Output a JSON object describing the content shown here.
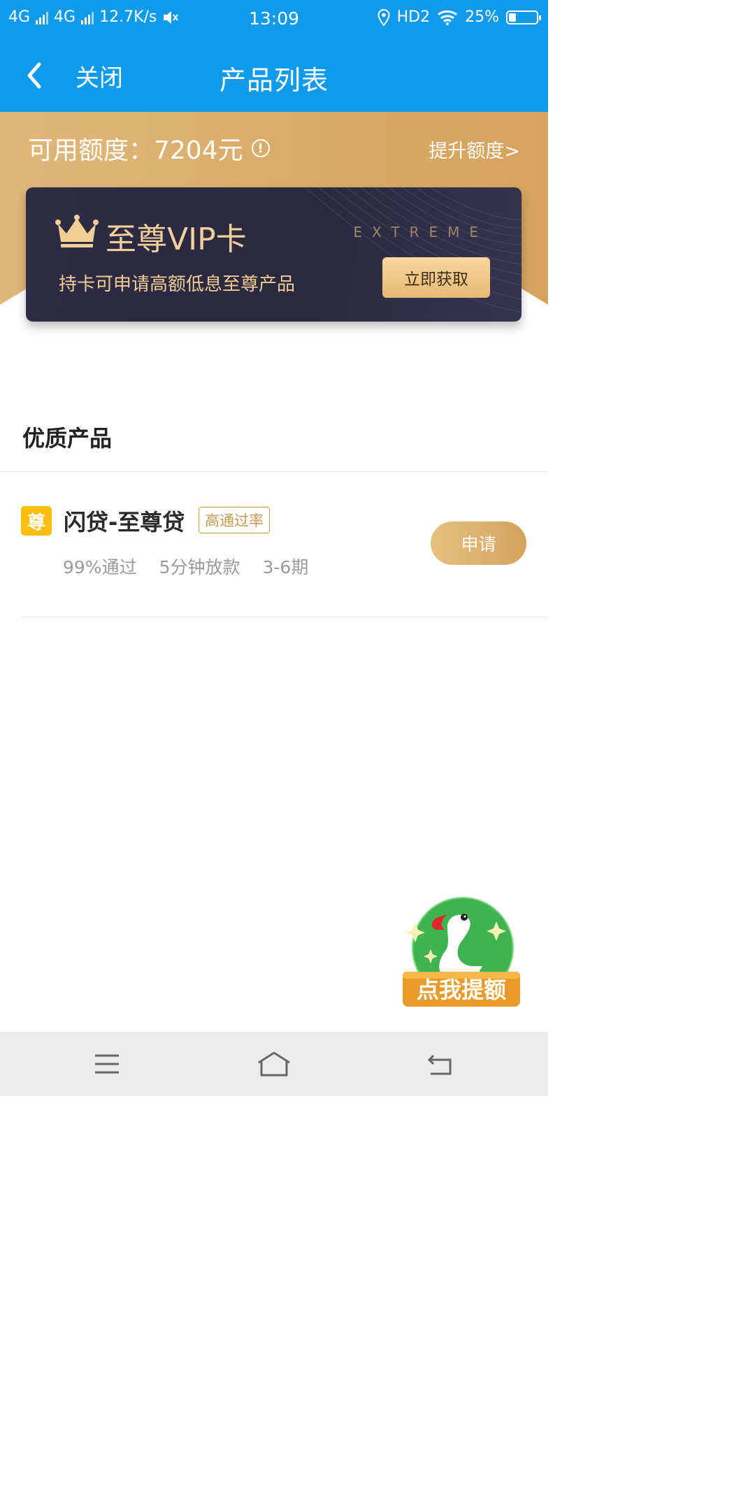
{
  "status_bar": {
    "network1": "4G",
    "network2": "4G",
    "speed": "12.7K/s",
    "time": "13:09",
    "hd": "HD2",
    "battery": "25%",
    "battery_level": 0.25
  },
  "nav": {
    "close_label": "关闭",
    "title": "产品列表"
  },
  "quota": {
    "label": "可用额度：7204元",
    "raise_link": "提升额度>"
  },
  "vip_card": {
    "title": "至尊VIP卡",
    "extreme": "EXTREME",
    "description": "持卡可申请高额低息至尊产品",
    "button": "立即获取"
  },
  "section": {
    "title": "优质产品"
  },
  "product": {
    "badge": "尊",
    "name": "闪贷-至尊贷",
    "tag": "高通过率",
    "features": [
      "99%通过",
      "5分钟放款",
      "3-6期"
    ],
    "apply": "申请"
  },
  "promo": {
    "label": "点我提额"
  },
  "colors": {
    "primary": "#0f9bea",
    "gold": "#d9aa66",
    "vip_bg": "#2e2c45",
    "badge": "#fbbd0f"
  }
}
